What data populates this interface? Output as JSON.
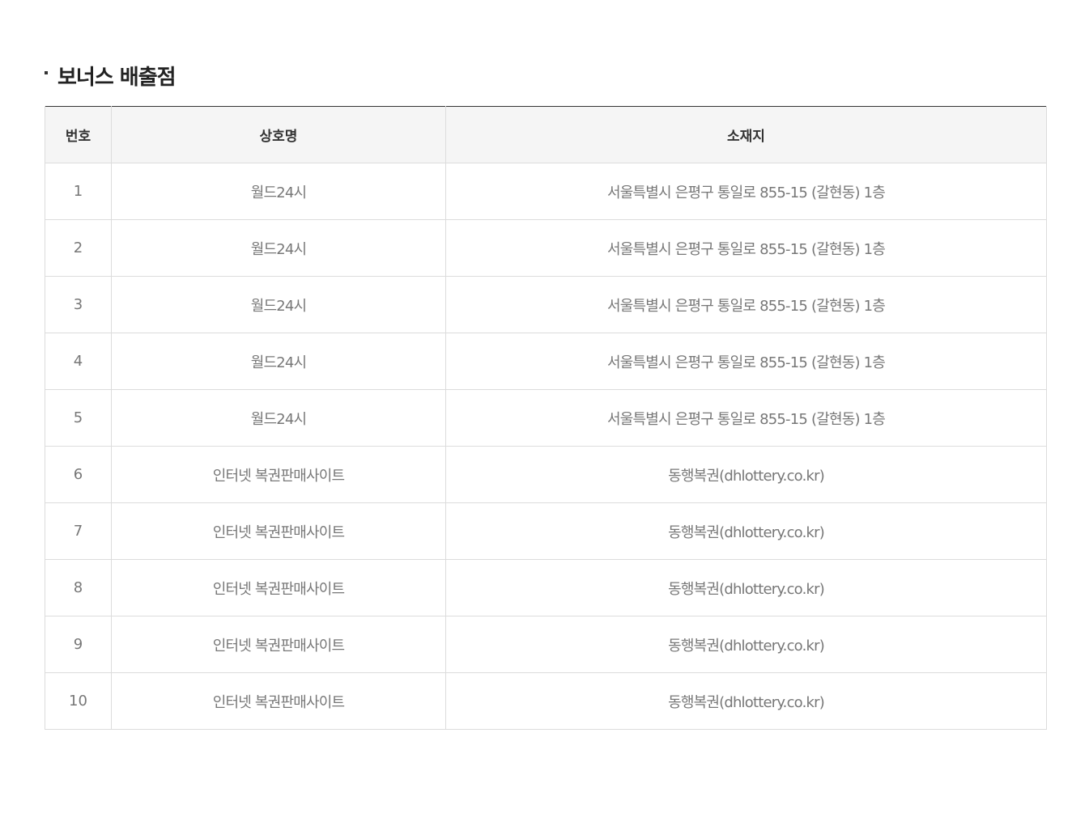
{
  "section": {
    "title": "보너스 배출점"
  },
  "table": {
    "headers": {
      "no": "번호",
      "name": "상호명",
      "address": "소재지"
    },
    "rows": [
      {
        "no": "1",
        "name": "월드24시",
        "address": "서울특별시 은평구 통일로 855-15 (갈현동) 1층"
      },
      {
        "no": "2",
        "name": "월드24시",
        "address": "서울특별시 은평구 통일로 855-15 (갈현동) 1층"
      },
      {
        "no": "3",
        "name": "월드24시",
        "address": "서울특별시 은평구 통일로 855-15 (갈현동) 1층"
      },
      {
        "no": "4",
        "name": "월드24시",
        "address": "서울특별시 은평구 통일로 855-15 (갈현동) 1층"
      },
      {
        "no": "5",
        "name": "월드24시",
        "address": "서울특별시 은평구 통일로 855-15 (갈현동) 1층"
      },
      {
        "no": "6",
        "name": "인터넷 복권판매사이트",
        "address": "동행복권(dhlottery.co.kr)"
      },
      {
        "no": "7",
        "name": "인터넷 복권판매사이트",
        "address": "동행복권(dhlottery.co.kr)"
      },
      {
        "no": "8",
        "name": "인터넷 복권판매사이트",
        "address": "동행복권(dhlottery.co.kr)"
      },
      {
        "no": "9",
        "name": "인터넷 복권판매사이트",
        "address": "동행복권(dhlottery.co.kr)"
      },
      {
        "no": "10",
        "name": "인터넷 복권판매사이트",
        "address": "동행복권(dhlottery.co.kr)"
      }
    ]
  }
}
